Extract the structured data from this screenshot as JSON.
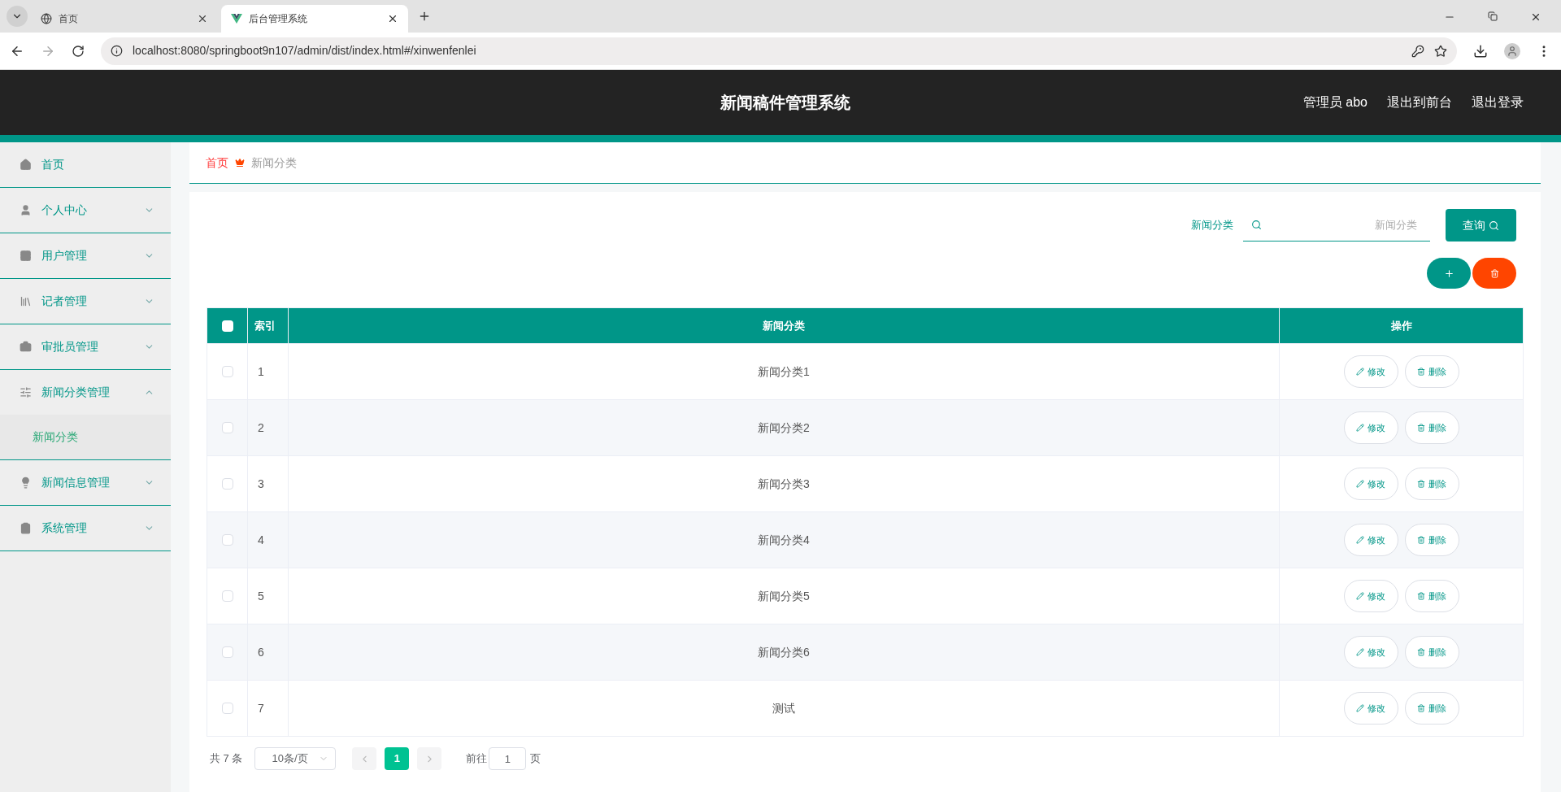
{
  "browser": {
    "tabs": [
      {
        "title": "首页",
        "selected": false
      },
      {
        "title": "后台管理系统",
        "selected": true
      }
    ],
    "url": "localhost:8080/springboot9n107/admin/dist/index.html#/xinwenfenlei"
  },
  "header": {
    "title": "新闻稿件管理系统",
    "links": [
      "管理员 abo",
      "退出到前台",
      "退出登录"
    ]
  },
  "sidebar": {
    "items": [
      {
        "label": "首页",
        "kind": "link"
      },
      {
        "label": "个人中心",
        "kind": "menu",
        "expanded": false
      },
      {
        "label": "用户管理",
        "kind": "menu",
        "expanded": false
      },
      {
        "label": "记者管理",
        "kind": "menu",
        "expanded": false
      },
      {
        "label": "审批员管理",
        "kind": "menu",
        "expanded": false
      },
      {
        "label": "新闻分类管理",
        "kind": "menu",
        "expanded": true,
        "children": [
          {
            "label": "新闻分类",
            "selected": true
          }
        ]
      },
      {
        "label": "新闻信息管理",
        "kind": "menu",
        "expanded": false
      },
      {
        "label": "系统管理",
        "kind": "menu",
        "expanded": false
      }
    ]
  },
  "breadcrumb": [
    "首页",
    "新闻分类"
  ],
  "search": {
    "label": "新闻分类",
    "placeholder": "新闻分类",
    "button": "查询"
  },
  "table": {
    "columns": [
      "索引",
      "新闻分类",
      "操作"
    ],
    "all_checked": false,
    "rows": [
      {
        "index": "1",
        "category": "新闻分类1",
        "checked": false,
        "actions": [
          "修改",
          "删除"
        ]
      },
      {
        "index": "2",
        "category": "新闻分类2",
        "checked": false,
        "actions": [
          "修改",
          "删除"
        ]
      },
      {
        "index": "3",
        "category": "新闻分类3",
        "checked": false,
        "actions": [
          "修改",
          "删除"
        ]
      },
      {
        "index": "4",
        "category": "新闻分类4",
        "checked": false,
        "actions": [
          "修改",
          "删除"
        ]
      },
      {
        "index": "5",
        "category": "新闻分类5",
        "checked": false,
        "actions": [
          "修改",
          "删除"
        ]
      },
      {
        "index": "6",
        "category": "新闻分类6",
        "checked": false,
        "actions": [
          "修改",
          "删除"
        ]
      },
      {
        "index": "7",
        "category": "测试",
        "checked": false,
        "actions": [
          "修改",
          "删除"
        ]
      }
    ]
  },
  "pagination": {
    "total": "共 7 条",
    "page_size": "10条/页",
    "pages": [
      {
        "label": "1",
        "selected": true
      }
    ],
    "goto_label": "前往",
    "goto_value": "1",
    "page_suffix": "页"
  }
}
